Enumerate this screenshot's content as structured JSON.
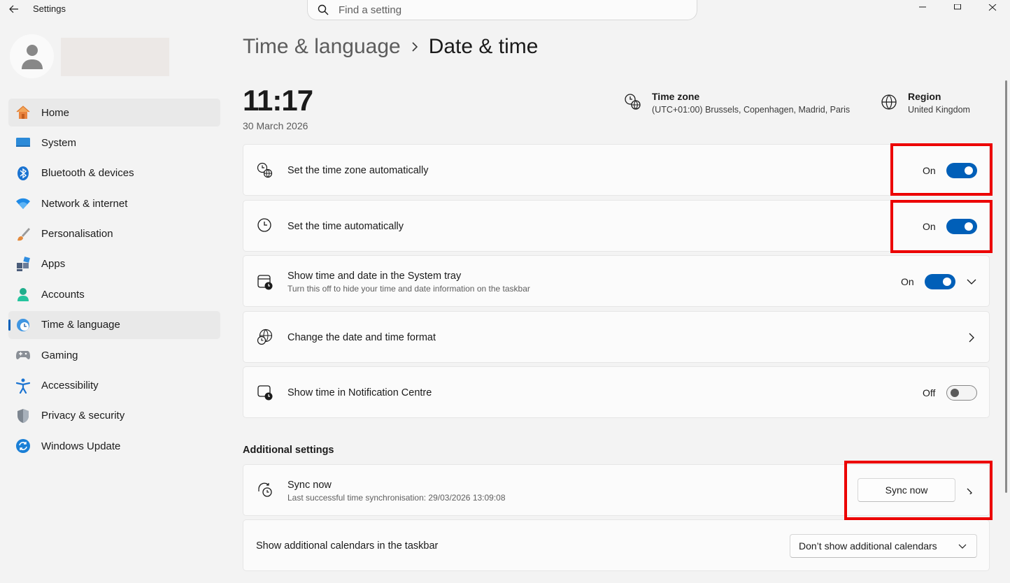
{
  "app": {
    "title": "Settings",
    "search_placeholder": "Find a setting"
  },
  "sidebar": {
    "items": [
      {
        "label": "Home",
        "icon": "home-icon",
        "active": false,
        "highlighted": true
      },
      {
        "label": "System",
        "icon": "system-icon"
      },
      {
        "label": "Bluetooth & devices",
        "icon": "bluetooth-icon"
      },
      {
        "label": "Network & internet",
        "icon": "wifi-icon"
      },
      {
        "label": "Personalisation",
        "icon": "brush-icon"
      },
      {
        "label": "Apps",
        "icon": "apps-icon"
      },
      {
        "label": "Accounts",
        "icon": "accounts-icon"
      },
      {
        "label": "Time & language",
        "icon": "time-language-icon",
        "active": true
      },
      {
        "label": "Gaming",
        "icon": "gamepad-icon"
      },
      {
        "label": "Accessibility",
        "icon": "accessibility-icon"
      },
      {
        "label": "Privacy & security",
        "icon": "shield-icon"
      },
      {
        "label": "Windows Update",
        "icon": "update-icon"
      }
    ]
  },
  "breadcrumb": {
    "parent": "Time & language",
    "separator": "›",
    "current": "Date & time"
  },
  "clock": {
    "time": "11:17",
    "date": "30 March 2026"
  },
  "time_zone": {
    "title": "Time zone",
    "value": "(UTC+01:00) Brussels, Copenhagen, Madrid, Paris"
  },
  "region": {
    "title": "Region",
    "value": "United Kingdom"
  },
  "settings": {
    "tz_auto": {
      "title": "Set the time zone automatically",
      "state": "On"
    },
    "time_auto": {
      "title": "Set the time automatically",
      "state": "On"
    },
    "tray": {
      "title": "Show time and date in the System tray",
      "subtitle": "Turn this off to hide your time and date information on the taskbar",
      "state": "On"
    },
    "format": {
      "title": "Change the date and time format"
    },
    "notif": {
      "title": "Show time in Notification Centre",
      "state": "Off"
    }
  },
  "additional": {
    "heading": "Additional settings",
    "sync": {
      "title": "Sync now",
      "subtitle": "Last successful time synchronisation: 29/03/2026 13:09:08",
      "button": "Sync now"
    },
    "calendars": {
      "title": "Show additional calendars in the taskbar",
      "selected": "Don’t show additional calendars"
    }
  },
  "colors": {
    "accent": "#005fb8",
    "highlight": "#ec0000"
  }
}
